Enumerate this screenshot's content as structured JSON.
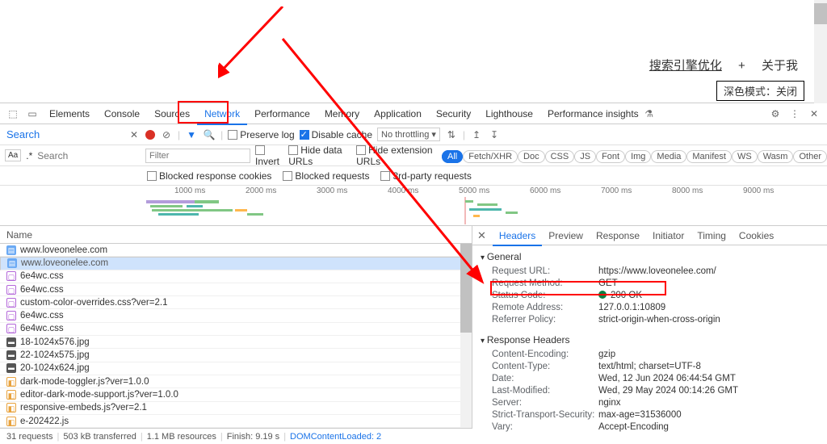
{
  "top": {
    "link1": "搜索引擎优化",
    "plus": "+",
    "link2": "关于我",
    "dark_mode": "深色模式：关闭"
  },
  "tabs": {
    "items": [
      "Elements",
      "Console",
      "Sources",
      "Network",
      "Performance",
      "Memory",
      "Application",
      "Security",
      "Lighthouse",
      "Performance insights"
    ],
    "active": 3
  },
  "toolbar": {
    "search_label": "Search",
    "preserve": "Preserve log",
    "disable": "Disable cache",
    "throttling": "No throttling",
    "aa": "Aa",
    "regex": ".*",
    "search_ph": "Search",
    "filter_ph": "Filter",
    "invert": "Invert",
    "hide_data": "Hide data URLs",
    "hide_ext": "Hide extension URLs",
    "types": [
      "All",
      "Fetch/XHR",
      "Doc",
      "CSS",
      "JS",
      "Font",
      "Img",
      "Media",
      "Manifest",
      "WS",
      "Wasm",
      "Other"
    ],
    "blocked_cookies": "Blocked response cookies",
    "blocked_req": "Blocked requests",
    "third_party": "3rd-party requests"
  },
  "timeline": {
    "ticks": [
      "1000 ms",
      "2000 ms",
      "3000 ms",
      "4000 ms",
      "5000 ms",
      "6000 ms",
      "7000 ms",
      "8000 ms",
      "9000 ms"
    ]
  },
  "list": {
    "header": "Name",
    "rows": [
      {
        "icon": "html",
        "name": "www.loveonelee.com",
        "sel": false
      },
      {
        "icon": "html",
        "name": "www.loveonelee.com",
        "sel": true
      },
      {
        "icon": "css",
        "name": "6e4wc.css",
        "sel": false
      },
      {
        "icon": "css",
        "name": "6e4wc.css",
        "sel": false
      },
      {
        "icon": "css",
        "name": "custom-color-overrides.css?ver=2.1",
        "sel": false
      },
      {
        "icon": "css",
        "name": "6e4wc.css",
        "sel": false
      },
      {
        "icon": "css",
        "name": "6e4wc.css",
        "sel": false
      },
      {
        "icon": "img",
        "name": "18-1024x576.jpg",
        "sel": false
      },
      {
        "icon": "img",
        "name": "22-1024x575.jpg",
        "sel": false
      },
      {
        "icon": "img",
        "name": "20-1024x624.jpg",
        "sel": false
      },
      {
        "icon": "js",
        "name": "dark-mode-toggler.js?ver=1.0.0",
        "sel": false
      },
      {
        "icon": "js",
        "name": "editor-dark-mode-support.js?ver=1.0.0",
        "sel": false
      },
      {
        "icon": "js",
        "name": "responsive-embeds.js?ver=2.1",
        "sel": false
      },
      {
        "icon": "js",
        "name": "e-202422.js",
        "sel": false
      }
    ]
  },
  "detail": {
    "tabs": [
      "Headers",
      "Preview",
      "Response",
      "Initiator",
      "Timing",
      "Cookies"
    ],
    "general_label": "General",
    "general": [
      {
        "k": "Request URL:",
        "v": "https://www.loveonelee.com/"
      },
      {
        "k": "Request Method:",
        "v": "GET"
      },
      {
        "k": "Status Code:",
        "v": "200 OK",
        "dot": true
      },
      {
        "k": "Remote Address:",
        "v": "127.0.0.1:10809"
      },
      {
        "k": "Referrer Policy:",
        "v": "strict-origin-when-cross-origin"
      }
    ],
    "resp_label": "Response Headers",
    "resp": [
      {
        "k": "Content-Encoding:",
        "v": "gzip"
      },
      {
        "k": "Content-Type:",
        "v": "text/html; charset=UTF-8"
      },
      {
        "k": "Date:",
        "v": "Wed, 12 Jun 2024 06:44:54 GMT"
      },
      {
        "k": "Last-Modified:",
        "v": "Wed, 29 May 2024 00:14:26 GMT"
      },
      {
        "k": "Server:",
        "v": "nginx"
      },
      {
        "k": "Strict-Transport-Security:",
        "v": "max-age=31536000"
      },
      {
        "k": "Vary:",
        "v": "Accept-Encoding"
      }
    ]
  },
  "status": {
    "reqs": "31 requests",
    "xfer": "503 kB transferred",
    "res": "1.1 MB resources",
    "finish": "Finish: 9.19 s",
    "dcl": "DOMContentLoaded: 2"
  }
}
